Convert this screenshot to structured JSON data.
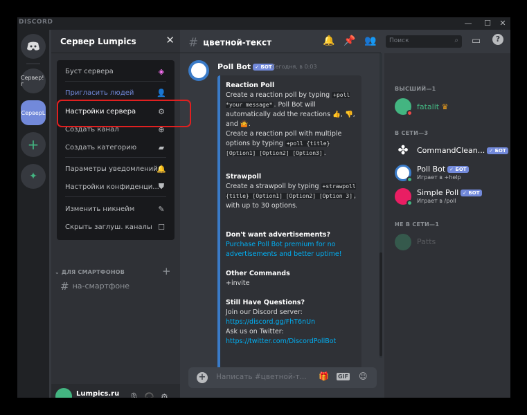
{
  "app": {
    "brand": "DISCORD"
  },
  "window_controls": {
    "min": "—",
    "max": "☐",
    "close": "✕"
  },
  "guilds": [
    {
      "label": "Сервер! г"
    },
    {
      "label": "СерверL"
    }
  ],
  "server": {
    "name": "Сервер Lumpics",
    "close": "✕"
  },
  "menu": {
    "items": [
      {
        "label": "Буст сервера"
      },
      {
        "label": "Пригласить людей"
      },
      {
        "label": "Настройки сервера"
      },
      {
        "label": "Создать канал"
      },
      {
        "label": "Создать категорию"
      },
      {
        "label": "Параметры уведомлений"
      },
      {
        "label": "Настройки конфиденци..."
      },
      {
        "label": "Изменить никнейм"
      },
      {
        "label": "Скрыть заглуш. каналы"
      }
    ]
  },
  "channels": {
    "category": "ДЛЯ СМАРТФОНОВ",
    "channel": "на-смартфоне"
  },
  "user": {
    "name": "Lumpics.ru",
    "tag": "fatalit"
  },
  "chat": {
    "channel": "цветной-текст",
    "search_placeholder": "Поиск",
    "composer_placeholder": "Написать #цветной-т..."
  },
  "message": {
    "author": "Poll Bot",
    "bot_tag": "БОТ",
    "time": "Сегодня, в 0:03",
    "embed": {
      "s1_title": "Reaction Poll",
      "s1_a": "Create a reaction poll by typing",
      "s1_code1": "+poll *your message*",
      "s1_b": ". Poll Bot will automatically add the reactions",
      "s1_c": ", and",
      "s1_d": "Create a reaction poll with multiple options by typing",
      "s1_code2": "+poll {title} [Option1] [Option2] [Option3]",
      "s2_title": "Strawpoll",
      "s2_a": "Create a strawpoll by typing",
      "s2_code": "+strawpoll {title} [Option1] [Option2] [Option 3]",
      "s2_b": ", with up to 30 options.",
      "s3_title": "Don't want advertisements?",
      "s3_link": "Purchase Poll Bot premium for no advertisements and better uptime!",
      "s4_title": "Other Commands",
      "s4_text": "+invite",
      "s5_title": "Still Have Questions?",
      "s5_a": "Join our Discord server:",
      "s5_link1": "https://discord.gg/FhT6nUn",
      "s5_b": "Ask us on Twitter:",
      "s5_link2": "https://twitter.com/DiscordPollBot"
    }
  },
  "members": {
    "cat_top": "ВЫСШИЙ—1",
    "cat_online": "В СЕТИ—3",
    "cat_offline": "НЕ В СЕТИ—1",
    "top": [
      {
        "name": "fatalit"
      }
    ],
    "online": [
      {
        "name": "CommandClean...",
        "tag": "БОТ",
        "sub": ""
      },
      {
        "name": "Poll Bot",
        "tag": "БОТ",
        "sub": "Играет в +help"
      },
      {
        "name": "Simple Poll",
        "tag": "БОТ",
        "sub": "Играет в /poll"
      }
    ],
    "offline": [
      {
        "name": "Patts"
      }
    ]
  },
  "colors": {
    "accent": "#7289da",
    "highlight": "#e02020",
    "online": "#43b581",
    "dnd": "#f04747",
    "link": "#00b0f4"
  }
}
